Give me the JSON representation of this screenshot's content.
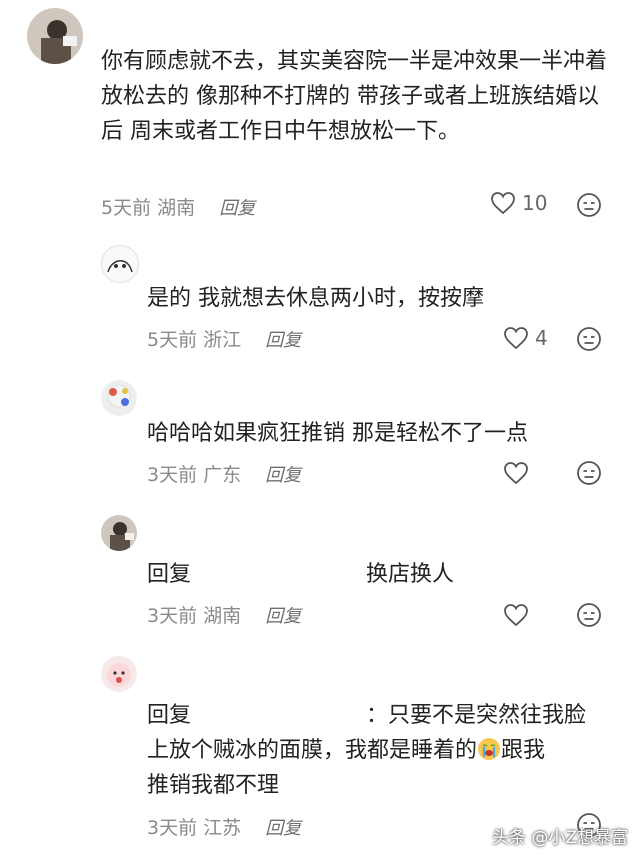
{
  "comments": [
    {
      "text": "你有顾虑就不去，其实美容院一半是冲效果一半冲着放松去的 像那种不打牌的 带孩子或者上班族结婚以后 周末或者工作日中午想放松一下。",
      "time": "5天前",
      "location": "湖南",
      "reply_label": "回复",
      "likes": "10"
    },
    {
      "text": "是的 我就想去休息两小时，按按摩",
      "time": "5天前",
      "location": "浙江",
      "reply_label": "回复",
      "likes": "4"
    },
    {
      "text": "哈哈哈如果疯狂推销 那是轻松不了一点",
      "time": "3天前",
      "location": "广东",
      "reply_label": "回复",
      "likes": ""
    },
    {
      "prefix": "回复",
      "text": "换店换人",
      "time": "3天前",
      "location": "湖南",
      "reply_label": "回复",
      "likes": ""
    },
    {
      "prefix": "回复",
      "separator": "：",
      "text_a": "只要不是突然往我脸",
      "text_b": "上放个贼冰的面膜，我都是睡着的",
      "text_c": "跟我",
      "text_d": "推销我都不理",
      "time": "3天前",
      "location": "江苏",
      "reply_label": "回复",
      "likes": ""
    }
  ],
  "icons": {
    "like": "heart-outline-icon",
    "dislike": "dislike-face-icon",
    "emoji": "crying-face-emoji"
  },
  "watermark": "头条 @小Z想暴富"
}
